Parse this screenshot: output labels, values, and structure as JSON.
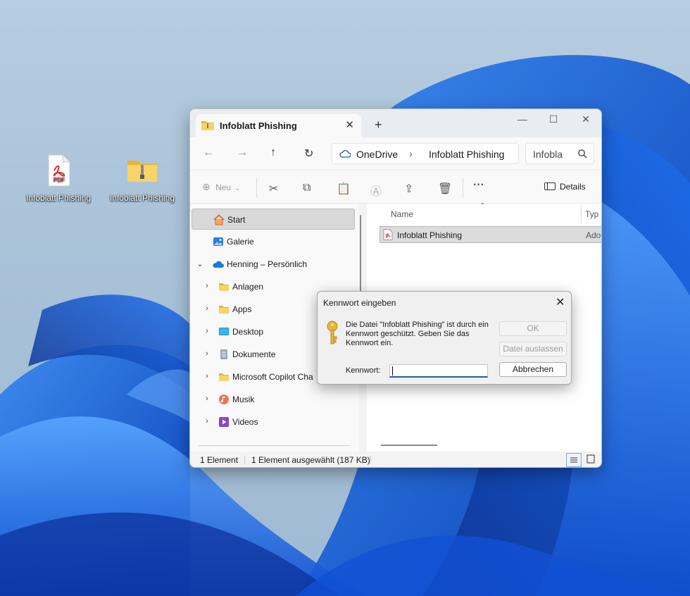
{
  "desktop": {
    "icons": [
      {
        "label": "Infoblatt Phishing",
        "icon": "pdf-file-icon",
        "pdf_badge": "PDF"
      },
      {
        "label": "Infoblatt Phishing",
        "icon": "zip-folder-icon"
      }
    ]
  },
  "explorer": {
    "tab_title": "Infoblatt Phishing",
    "address": {
      "segments": [
        "OneDrive",
        "Infoblatt Phishing"
      ]
    },
    "search": {
      "value": "Infobla"
    },
    "toolbar": {
      "new_label": "Neu",
      "details_label": "Details"
    },
    "sidebar": {
      "items": [
        {
          "label": "Start",
          "icon": "home-icon",
          "selected": true
        },
        {
          "label": "Galerie",
          "icon": "gallery-icon"
        },
        {
          "label": "Henning – Persönlich",
          "icon": "onedrive-cloud-icon",
          "expanded": true
        },
        {
          "label": "Anlagen",
          "icon": "folder-icon"
        },
        {
          "label": "Apps",
          "icon": "folder-icon"
        },
        {
          "label": "Desktop",
          "icon": "desktop-icon"
        },
        {
          "label": "Dokumente",
          "icon": "documents-icon"
        },
        {
          "label": "Microsoft Copilot Cha",
          "icon": "folder-icon"
        },
        {
          "label": "Musik",
          "icon": "music-icon"
        },
        {
          "label": "Videos",
          "icon": "videos-icon"
        }
      ]
    },
    "columns": {
      "name": "Name",
      "type": "Typ"
    },
    "files": [
      {
        "name": "Infoblatt Phishing",
        "type": "Adob",
        "icon": "pdf-file-icon"
      }
    ],
    "status": {
      "count": "1 Element",
      "selection": "1 Element ausgewählt (187 KB)"
    }
  },
  "dialog": {
    "title": "Kennwort eingeben",
    "message": "Die Datei \"Infoblatt Phishing\" ist durch ein Kennwort geschützt. Geben Sie das Kennwort ein.",
    "ok_label": "OK",
    "skip_label": "Datei auslassen",
    "cancel_label": "Abbrechen",
    "password_label": "Kennwort:",
    "password_value": ""
  },
  "colors": {
    "accent": "#1b5fa8",
    "folder": "#f5c542",
    "pdf_red": "#d9342b"
  }
}
